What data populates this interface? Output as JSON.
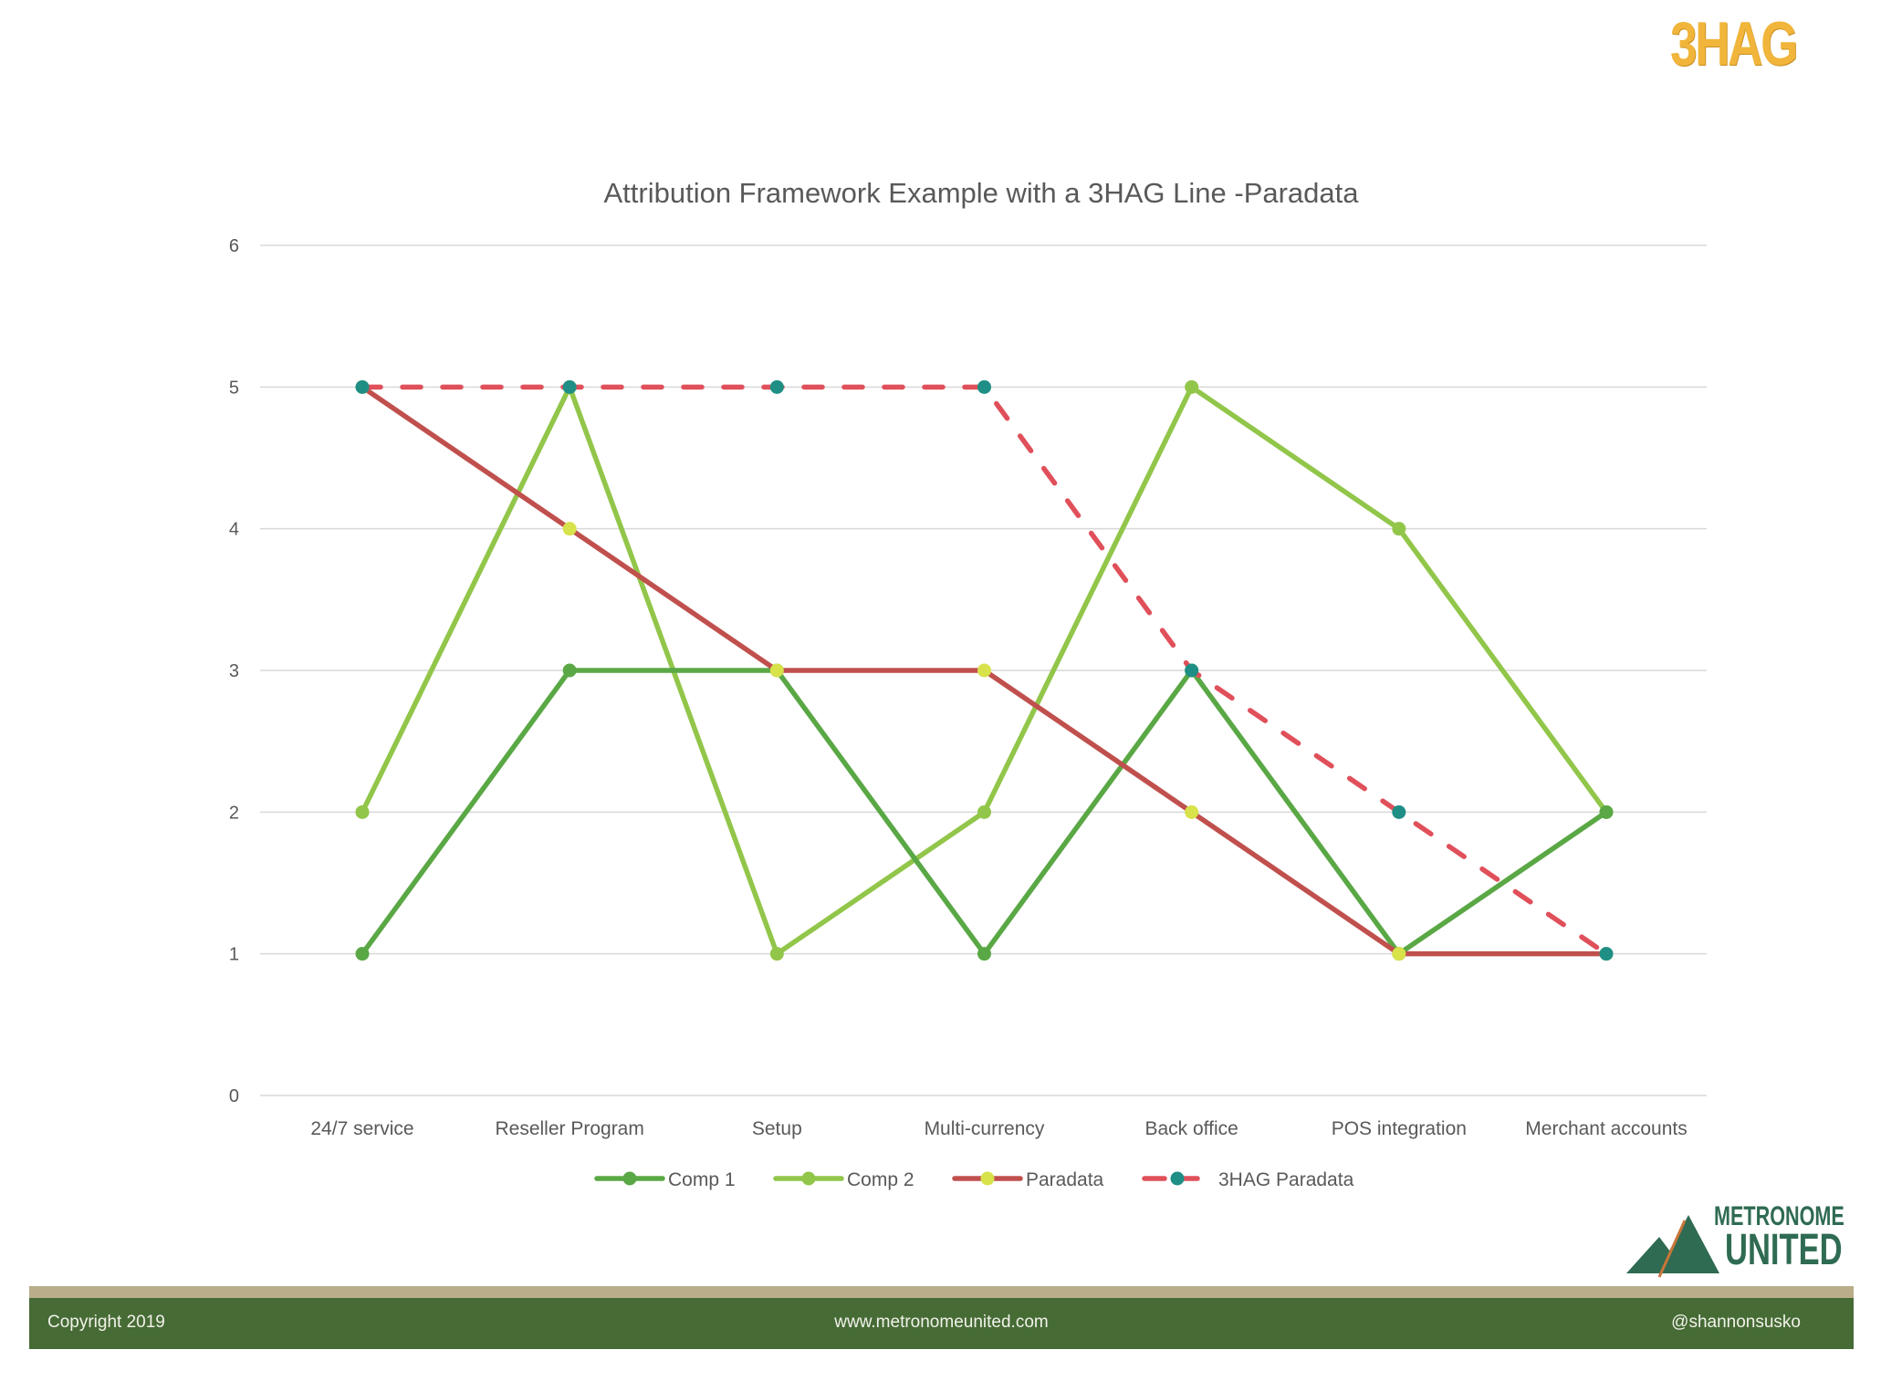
{
  "branding": {
    "top_logo_text": "3HAG",
    "bottom_logo_line1": "METRONOME",
    "bottom_logo_line2": "UNITED"
  },
  "footer": {
    "copyright": "Copyright 2019",
    "website": "www.metronomeunited.com",
    "handle": "@shannonsusko"
  },
  "colors": {
    "comp1": "#5aa845",
    "comp2": "#92c64a",
    "paradata_line": "#c0504d",
    "paradata_marker": "#d8e24a",
    "hag_line": "#e0505a",
    "hag_marker": "#1f8f86",
    "grid": "#d9d9d9",
    "footer_green": "#466b35",
    "footer_tan": "#b9ad8a"
  },
  "chart_data": {
    "type": "line",
    "title": "Attribution Framework Example with a 3HAG Line -Paradata",
    "xlabel": "",
    "ylabel": "",
    "categories": [
      "24/7 service",
      "Reseller Program",
      "Setup",
      "Multi-currency",
      "Back office",
      "POS integration",
      "Merchant accounts"
    ],
    "ylim": [
      0,
      6
    ],
    "yticks": [
      "0",
      "1",
      "2",
      "3",
      "4",
      "5",
      "6"
    ],
    "grid": true,
    "legend_position": "bottom",
    "series": [
      {
        "name": "Comp 1",
        "values": [
          1,
          3,
          3,
          1,
          3,
          1,
          2
        ],
        "style": "solid",
        "line_color": "#5aa845",
        "marker_color": "#5aa845"
      },
      {
        "name": "Comp 2",
        "values": [
          2,
          5,
          1,
          2,
          5,
          4,
          2
        ],
        "style": "solid",
        "line_color": "#92c64a",
        "marker_color": "#92c64a"
      },
      {
        "name": "Paradata",
        "values": [
          5,
          4,
          3,
          3,
          2,
          1,
          1
        ],
        "style": "solid",
        "line_color": "#c0504d",
        "marker_color": "#d8e24a"
      },
      {
        "name": "3HAG Paradata",
        "values": [
          5,
          5,
          5,
          5,
          3,
          2,
          1
        ],
        "style": "dashed",
        "line_color": "#e0505a",
        "marker_color": "#1f8f86"
      }
    ]
  }
}
